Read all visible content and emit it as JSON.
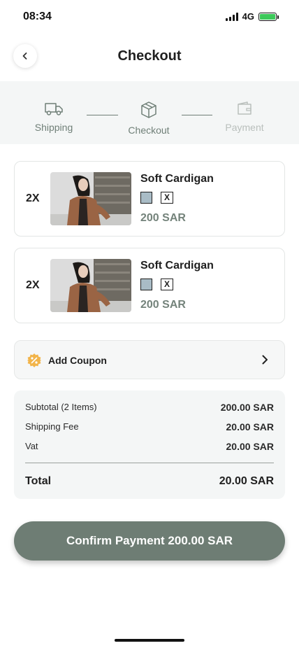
{
  "status_bar": {
    "time": "08:34",
    "network": "4G"
  },
  "header": {
    "title": "Checkout"
  },
  "stepper": {
    "steps": [
      {
        "label": "Shipping",
        "icon": "truck-icon",
        "state": "done"
      },
      {
        "label": "Checkout",
        "icon": "box-icon",
        "state": "active"
      },
      {
        "label": "Payment",
        "icon": "wallet-icon",
        "state": "inactive"
      }
    ]
  },
  "cart": {
    "items": [
      {
        "quantity": "2X",
        "name": "Soft Cardigan",
        "color_swatch": "#a9bcc6",
        "size": "X",
        "price": "200 SAR"
      },
      {
        "quantity": "2X",
        "name": "Soft Cardigan",
        "color_swatch": "#a9bcc6",
        "size": "X",
        "price": "200 SAR"
      }
    ]
  },
  "coupon": {
    "label": "Add Coupon",
    "icon": "coupon-percent-icon"
  },
  "summary": {
    "subtotal_label": "Subtotal (2 Items)",
    "subtotal_value": "200.00 SAR",
    "shipping_label": "Shipping Fee",
    "shipping_value": "20.00 SAR",
    "vat_label": "Vat",
    "vat_value": "20.00 SAR",
    "total_label": "Total",
    "total_value": "20.00 SAR"
  },
  "confirm_button": {
    "label": "Confirm Payment 200.00 SAR"
  },
  "colors": {
    "accent": "#6e7d74",
    "step_active": "#6f7f77",
    "step_inactive": "#b9bfbc",
    "coupon_icon": "#f2b44a",
    "battery": "#3cc95a"
  }
}
